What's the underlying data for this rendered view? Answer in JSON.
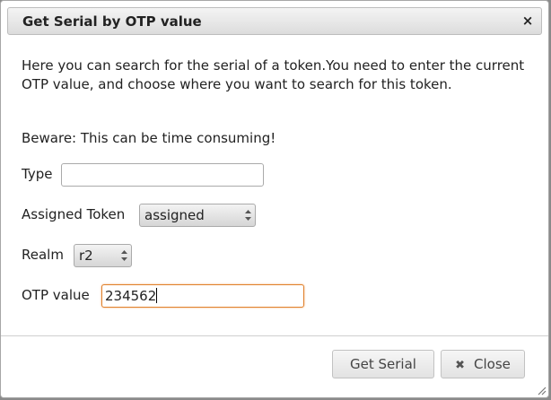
{
  "dialog": {
    "title": "Get Serial by OTP value",
    "close_glyph": "×",
    "close_icon": "close-icon"
  },
  "content": {
    "intro": "Here you can search for the serial of a token.You need to enter the current OTP value, and choose where you want to search for this token.",
    "warning": "Beware: This can be time consuming!"
  },
  "form": {
    "type": {
      "label": "Type",
      "value": ""
    },
    "assigned": {
      "label": "Assigned Token",
      "selected": "assigned"
    },
    "realm": {
      "label": "Realm",
      "selected": "r2"
    },
    "otp": {
      "label": "OTP value",
      "value": "234562"
    }
  },
  "buttons": {
    "get_serial": "Get Serial",
    "close": "Close",
    "close_glyph": "✖"
  },
  "colors": {
    "focus_border": "#e0812c",
    "titlebar": "#e6e6e6"
  }
}
